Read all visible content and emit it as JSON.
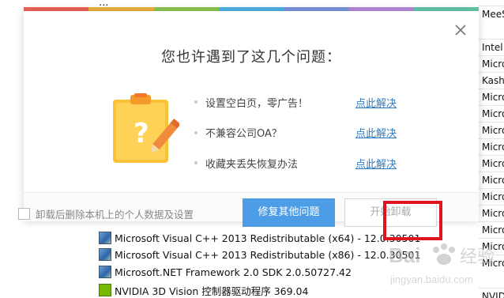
{
  "background": {
    "top_partial": "…",
    "programs": [
      {
        "name": "Microsoft Visual C++ 2013 Redistributable (x64) - 12.0.30501",
        "icon": "installer-icon"
      },
      {
        "name": "Microsoft Visual C++ 2013 Redistributable (x86) - 12.0.30501",
        "icon": "installer-icon"
      },
      {
        "name": "Microsoft.NET Framework 2.0 SDK 2.0.50727.42",
        "icon": "installer-icon"
      },
      {
        "name": "NVIDIA 3D Vision 控制器驱动程序 369.04",
        "icon": "nvidia-icon"
      }
    ],
    "publishers": [
      "MeeS",
      "Intel",
      "Micro",
      "Kash",
      "Micro",
      "Micro",
      "Micro",
      "Micro",
      "Micro",
      "Micro",
      "Micro",
      "Micro",
      "Micro",
      "Micro",
      "Micro",
      "Micro",
      "NVID"
    ]
  },
  "dialog": {
    "title": "您也许遇到了这几个问题：",
    "rainbow_colors": [
      "#f0645a",
      "#f0b43c",
      "#8cc850",
      "#50b4e6",
      "#7896dc",
      "#b48cdc",
      "#64c8aa"
    ],
    "issues": [
      {
        "text": "设置空白页，零广告！",
        "link": "点此解决"
      },
      {
        "text": "不兼容公司OA？",
        "link": "点此解决"
      },
      {
        "text": "收藏夹丢失恢复办法",
        "link": "点此解决"
      }
    ],
    "checkbox_label": "卸载后删除本机上的个人数据及设置",
    "checkbox_checked": false,
    "fix_button": "修复其他问题",
    "uninstall_button": "开始卸载",
    "accent_color": "#4d9de6",
    "link_color": "#2d7cc8",
    "highlight_color": "#e0141e"
  },
  "watermark": {
    "brand": "Bai",
    "brand2": "经验",
    "url": "jingyan.baidu.com"
  }
}
